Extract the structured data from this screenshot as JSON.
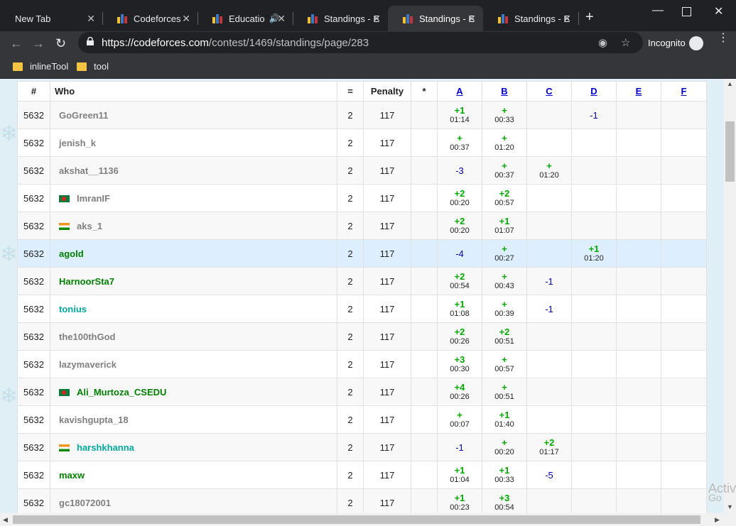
{
  "tabs": [
    {
      "title": "New Tab",
      "active": false,
      "icon": "none"
    },
    {
      "title": "Codeforces",
      "active": false,
      "icon": "codeforces-icon"
    },
    {
      "title": "Educatio",
      "active": false,
      "icon": "codeforces-icon",
      "audio": true
    },
    {
      "title": "Standings - E",
      "active": false,
      "icon": "codeforces-icon"
    },
    {
      "title": "Standings - E",
      "active": true,
      "icon": "codeforces-icon"
    },
    {
      "title": "Standings - E",
      "active": false,
      "icon": "codeforces-icon"
    }
  ],
  "url": {
    "host": "https://codeforces.com",
    "path": "/contest/1469/standings/page/283"
  },
  "incognito_label": "Incognito",
  "bookmarks": [
    "inlineTool",
    "tool"
  ],
  "table": {
    "headers": [
      "#",
      "Who",
      "=",
      "Penalty",
      "*",
      "A",
      "B",
      "C",
      "D",
      "E",
      "F"
    ],
    "rows": [
      {
        "rank": "5632",
        "who": "GoGreen11",
        "color": "gray",
        "flag": "",
        "solved": "2",
        "penalty": "117",
        "hack": "",
        "cells": [
          {
            "s": "+1",
            "t": "01:14"
          },
          {
            "s": "+",
            "t": "00:33"
          },
          null,
          {
            "r": "-1"
          },
          null,
          null
        ]
      },
      {
        "rank": "5632",
        "who": "jenish_k",
        "color": "gray",
        "flag": "",
        "solved": "2",
        "penalty": "117",
        "hack": "",
        "cells": [
          {
            "s": "+",
            "t": "00:37"
          },
          {
            "s": "+",
            "t": "01:20"
          },
          null,
          null,
          null,
          null
        ]
      },
      {
        "rank": "5632",
        "who": "akshat__1136",
        "color": "gray",
        "flag": "",
        "solved": "2",
        "penalty": "117",
        "hack": "",
        "cells": [
          {
            "r": "-3"
          },
          {
            "s": "+",
            "t": "00:37"
          },
          {
            "s": "+",
            "t": "01:20"
          },
          null,
          null,
          null
        ]
      },
      {
        "rank": "5632",
        "who": "ImranIF",
        "color": "gray",
        "flag": "bd",
        "solved": "2",
        "penalty": "117",
        "hack": "",
        "cells": [
          {
            "s": "+2",
            "t": "00:20"
          },
          {
            "s": "+2",
            "t": "00:57"
          },
          null,
          null,
          null,
          null
        ]
      },
      {
        "rank": "5632",
        "who": "aks_1",
        "color": "gray",
        "flag": "in",
        "solved": "2",
        "penalty": "117",
        "hack": "",
        "cells": [
          {
            "s": "+2",
            "t": "00:20"
          },
          {
            "s": "+1",
            "t": "01:07"
          },
          null,
          null,
          null,
          null
        ]
      },
      {
        "rank": "5632",
        "who": "agold",
        "color": "green",
        "flag": "",
        "solved": "2",
        "penalty": "117",
        "hack": "",
        "highlight": true,
        "cells": [
          {
            "r": "-4"
          },
          {
            "s": "+",
            "t": "00:27"
          },
          null,
          {
            "s": "+1",
            "t": "01:20"
          },
          null,
          null
        ]
      },
      {
        "rank": "5632",
        "who": "HarnoorSta7",
        "color": "green",
        "flag": "",
        "solved": "2",
        "penalty": "117",
        "hack": "",
        "cells": [
          {
            "s": "+2",
            "t": "00:54"
          },
          {
            "s": "+",
            "t": "00:43"
          },
          {
            "r": "-1"
          },
          null,
          null,
          null
        ]
      },
      {
        "rank": "5632",
        "who": "tonius",
        "color": "cyan",
        "flag": "",
        "solved": "2",
        "penalty": "117",
        "hack": "",
        "cells": [
          {
            "s": "+1",
            "t": "01:08"
          },
          {
            "s": "+",
            "t": "00:39"
          },
          {
            "r": "-1"
          },
          null,
          null,
          null
        ]
      },
      {
        "rank": "5632",
        "who": "the100thGod",
        "color": "gray",
        "flag": "",
        "solved": "2",
        "penalty": "117",
        "hack": "",
        "cells": [
          {
            "s": "+2",
            "t": "00:26"
          },
          {
            "s": "+2",
            "t": "00:51"
          },
          null,
          null,
          null,
          null
        ]
      },
      {
        "rank": "5632",
        "who": "lazymaverick",
        "color": "gray",
        "flag": "",
        "solved": "2",
        "penalty": "117",
        "hack": "",
        "cells": [
          {
            "s": "+3",
            "t": "00:30"
          },
          {
            "s": "+",
            "t": "00:57"
          },
          null,
          null,
          null,
          null
        ]
      },
      {
        "rank": "5632",
        "who": "Ali_Murtoza_CSEDU",
        "color": "green",
        "flag": "bd",
        "solved": "2",
        "penalty": "117",
        "hack": "",
        "cells": [
          {
            "s": "+4",
            "t": "00:26"
          },
          {
            "s": "+",
            "t": "00:51"
          },
          null,
          null,
          null,
          null
        ]
      },
      {
        "rank": "5632",
        "who": "kavishgupta_18",
        "color": "gray",
        "flag": "",
        "solved": "2",
        "penalty": "117",
        "hack": "",
        "cells": [
          {
            "s": "+",
            "t": "00:07"
          },
          {
            "s": "+1",
            "t": "01:40"
          },
          null,
          null,
          null,
          null
        ]
      },
      {
        "rank": "5632",
        "who": "harshkhanna",
        "color": "cyan",
        "flag": "in",
        "solved": "2",
        "penalty": "117",
        "hack": "",
        "cells": [
          {
            "r": "-1"
          },
          {
            "s": "+",
            "t": "00:20"
          },
          {
            "s": "+2",
            "t": "01:17"
          },
          null,
          null,
          null
        ]
      },
      {
        "rank": "5632",
        "who": "maxw",
        "color": "green",
        "flag": "",
        "solved": "2",
        "penalty": "117",
        "hack": "",
        "cells": [
          {
            "s": "+1",
            "t": "01:04"
          },
          {
            "s": "+1",
            "t": "00:33"
          },
          {
            "r": "-5"
          },
          null,
          null,
          null
        ]
      },
      {
        "rank": "5632",
        "who": "gc18072001",
        "color": "gray",
        "flag": "",
        "solved": "2",
        "penalty": "117",
        "hack": "",
        "cells": [
          {
            "s": "+1",
            "t": "00:23"
          },
          {
            "s": "+3",
            "t": "00:54"
          },
          null,
          null,
          null,
          null
        ]
      }
    ]
  },
  "watermark": {
    "line1": "Activ",
    "line2": "Go"
  }
}
